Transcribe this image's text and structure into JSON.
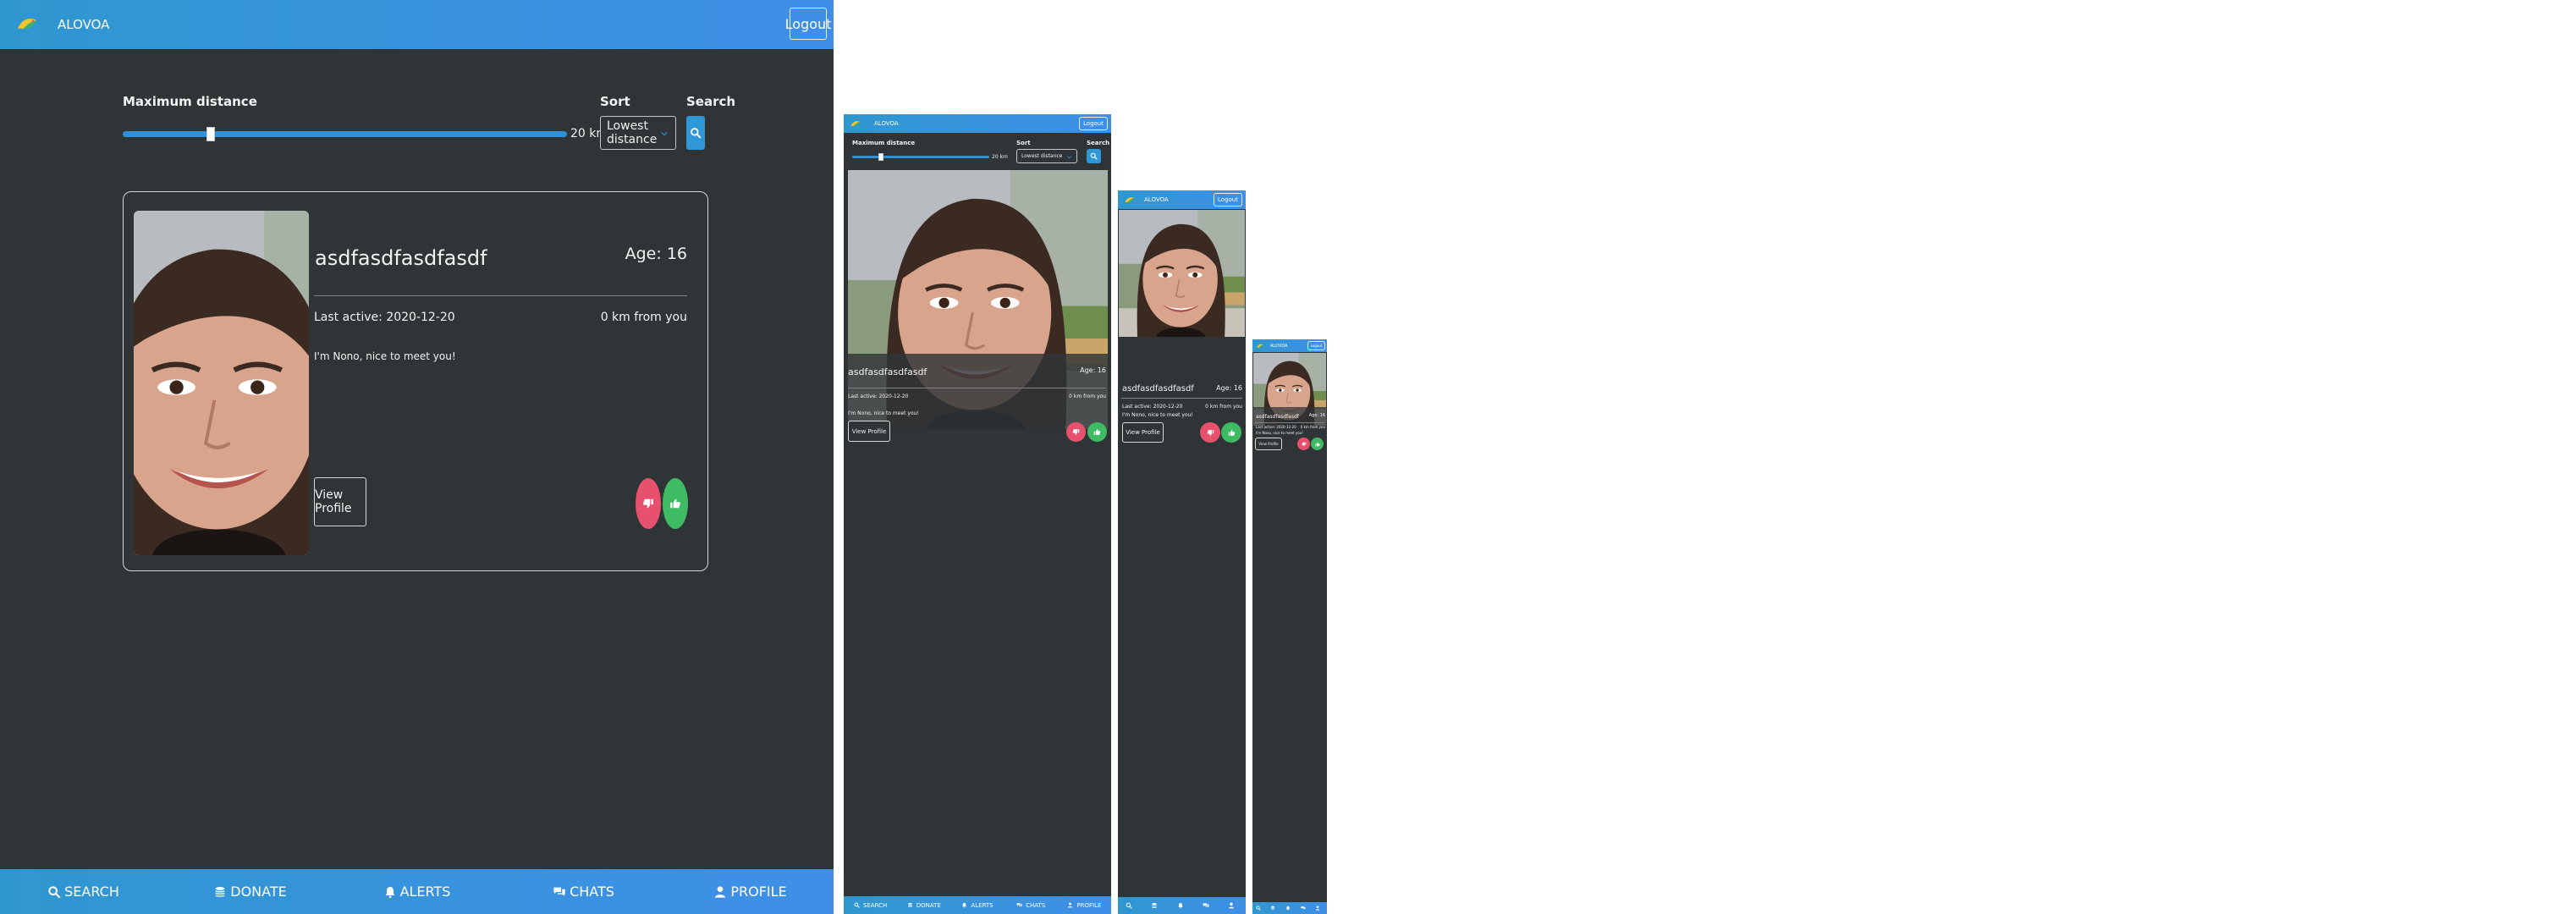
{
  "app": {
    "brand": "ALOVOA",
    "logout_label": "Logout"
  },
  "filters": {
    "distance_label": "Maximum distance",
    "distance_value": "20 km",
    "distance_fraction": 0.2,
    "sort_label": "Sort",
    "sort_value": "Lowest distance",
    "search_label": "Search"
  },
  "profile": {
    "name": "asdfasdfasdfasdf",
    "age": "Age: 16",
    "last_active": "Last active: 2020-12-20",
    "distance": "0 km from you",
    "bio": "I'm Nono, nice to meet you!",
    "view_profile_label": "View Profile"
  },
  "bottom_nav": {
    "items": [
      {
        "label": "SEARCH",
        "icon": "search-icon"
      },
      {
        "label": "DONATE",
        "icon": "coins-icon"
      },
      {
        "label": "ALERTS",
        "icon": "bell-icon"
      },
      {
        "label": "CHATS",
        "icon": "comments-icon"
      },
      {
        "label": "PROFILE",
        "icon": "user-icon"
      }
    ]
  },
  "colors": {
    "accent": "#2f97d6",
    "background": "#2f3437",
    "like": "#3fbb64",
    "dislike": "#e8516d"
  }
}
